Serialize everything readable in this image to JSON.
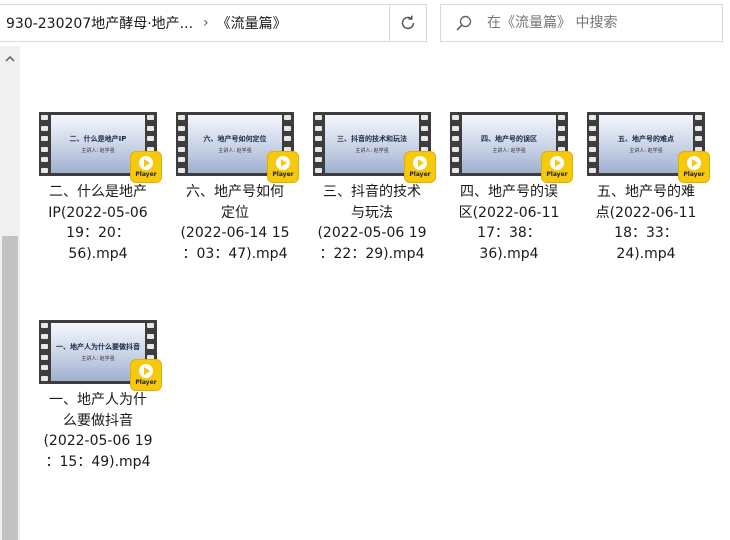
{
  "toolbar": {
    "path_parent": "930-230207地产酵母·地产...",
    "path_separator": "›",
    "path_current": "《流量篇》",
    "search_placeholder": "在《流量篇》 中搜索"
  },
  "icons": {
    "dropdown": "chevron-down-icon",
    "refresh": "refresh-icon",
    "search": "search-icon",
    "scroll_up": "chevron-up-icon",
    "file_badge": "player-icon"
  },
  "colors": {
    "badge": "#f6c90e",
    "film": "#3d3d3d",
    "scroll_thumb": "#c2c2c2"
  },
  "files": [
    {
      "thumb_title": "二、什么是地产IP",
      "thumb_sub": "主讲人: 赵学强",
      "badge_label": "Player",
      "name_lines": [
        "二、什么是地产",
        "IP(2022-05-06",
        "19：20：",
        "56).mp4"
      ]
    },
    {
      "thumb_title": "六、地产号如何定位",
      "thumb_sub": "主讲人: 赵学强",
      "badge_label": "Player",
      "name_lines": [
        "六、地产号如何",
        "定位",
        "(2022-06-14 15",
        "：03：47).mp4"
      ]
    },
    {
      "thumb_title": "三、抖音的技术和玩法",
      "thumb_sub": "主讲人: 赵学强",
      "badge_label": "Player",
      "name_lines": [
        "三、抖音的技术",
        "与玩法",
        "(2022-05-06 19",
        "：22：29).mp4"
      ]
    },
    {
      "thumb_title": "四、地产号的误区",
      "thumb_sub": "主讲人: 赵学强",
      "badge_label": "Player",
      "name_lines": [
        "四、地产号的误",
        "区(2022-06-11",
        "17：38：",
        "36).mp4"
      ]
    },
    {
      "thumb_title": "五、地产号的难点",
      "thumb_sub": "主讲人: 赵学强",
      "badge_label": "Player",
      "name_lines": [
        "五、地产号的难",
        "点(2022-06-11",
        "18：33：",
        "24).mp4"
      ]
    },
    {
      "thumb_title": "一、地产人为什么要做抖音",
      "thumb_sub": "主讲人: 赵学强",
      "badge_label": "Player",
      "name_lines": [
        "一、地产人为什",
        "么要做抖音",
        "(2022-05-06 19",
        "：15：49).mp4"
      ]
    }
  ]
}
